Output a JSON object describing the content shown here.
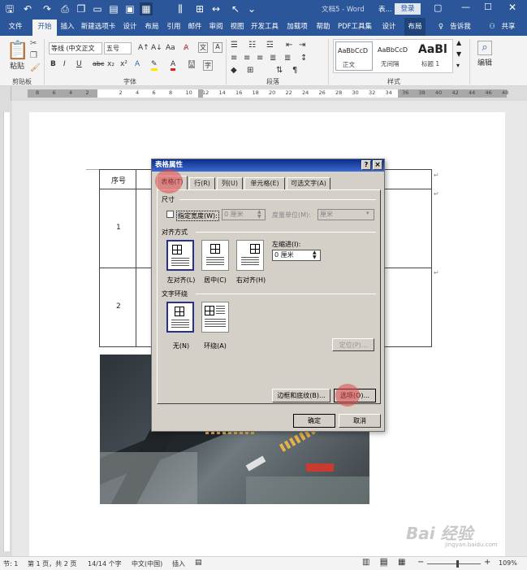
{
  "app": {
    "title": "文档5 - Word",
    "table_context": "表...",
    "login": "登录"
  },
  "ribbon_tabs": [
    "文件",
    "开始",
    "插入",
    "新建选项卡",
    "设计",
    "布局",
    "引用",
    "邮件",
    "审阅",
    "视图",
    "开发工具",
    "加载项",
    "帮助",
    "PDF工具集",
    "设计",
    "布局"
  ],
  "tell_me": "告诉我",
  "share": "共享",
  "clipboard": {
    "paste": "粘贴",
    "label": "剪贴板"
  },
  "font": {
    "name": "等线 (中文正文",
    "size": "五号",
    "label": "字体",
    "b": "B",
    "i": "I",
    "u": "U",
    "strike": "abc",
    "sub": "x₂",
    "sup": "x²",
    "aa": "Aa",
    "grow": "A↑",
    "shrink": "A↓"
  },
  "paragraph": {
    "label": "段落"
  },
  "styles": {
    "label": "样式",
    "items": [
      {
        "preview": "AaBbCcD",
        "name": "正文"
      },
      {
        "preview": "AaBbCcD",
        "name": "无间隔"
      },
      {
        "preview": "AaBl",
        "name": "标题 1"
      }
    ]
  },
  "editing": {
    "label": "编辑"
  },
  "ruler": {
    "marks": [
      "8",
      "6",
      "4",
      "2",
      "",
      "2",
      "4",
      "6",
      "8",
      "10",
      "12",
      "14",
      "16",
      "18",
      "20",
      "22",
      "24",
      "26",
      "28",
      "30",
      "32",
      "34",
      "36",
      "38",
      "40",
      "42",
      "44",
      "46",
      "48"
    ]
  },
  "doc_table": {
    "header": "序号",
    "rows": [
      "1",
      "2"
    ]
  },
  "dialog": {
    "title": "表格属性",
    "help": "?",
    "close": "×",
    "tabs": [
      "表格(T)",
      "行(R)",
      "列(U)",
      "单元格(E)",
      "可选文字(A)"
    ],
    "size_section": "尺寸",
    "pref_width_label": "指定宽度(W):",
    "pref_width_value": "0 厘米",
    "measure_label": "度量单位(M):",
    "measure_value": "厘米",
    "align_section": "对齐方式",
    "align_options": [
      "左对齐(L)",
      "居中(C)",
      "右对齐(H)"
    ],
    "indent_label": "左缩进(I):",
    "indent_value": "0 厘米",
    "wrap_section": "文字环绕",
    "wrap_options": [
      "无(N)",
      "环绕(A)"
    ],
    "position_btn": "定位(P)...",
    "borders_btn": "边框和底纹(B)...",
    "options_btn": "选项(O)...",
    "ok": "确定",
    "cancel": "取消"
  },
  "status": {
    "section": "节: 1",
    "page": "第 1 页，共 2 页",
    "words": "14/14 个字",
    "lang": "中文(中国)",
    "insert": "插入",
    "zoom": "109%"
  },
  "watermark": {
    "text": "Bai 经验",
    "url": "jingyan.baidu.com"
  }
}
